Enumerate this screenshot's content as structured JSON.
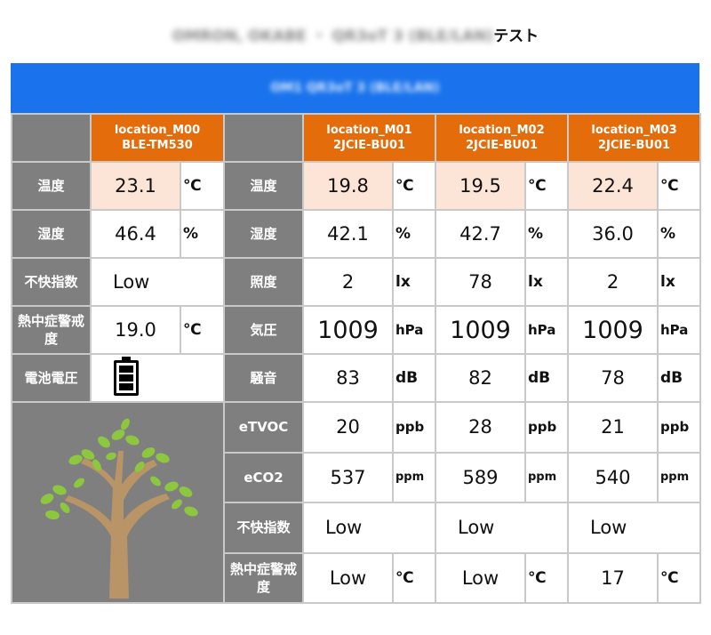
{
  "page_title": {
    "blurred": "OMRON, OKABE ・ QR3oT 3 (BLE/LAN)",
    "suffix": "テスト"
  },
  "banner": "OM1 QR3oT 3 (BLE/LAN)",
  "m00": {
    "header_line1": "location_M00",
    "header_line2": "BLE-TM530"
  },
  "m00_rows": [
    {
      "label": "温度",
      "value": "23.1",
      "unit": "℃"
    },
    {
      "label": "湿度",
      "value": "46.4",
      "unit": "%"
    },
    {
      "label": "不快指数",
      "value": "Low"
    },
    {
      "label": "熱中症警戒度",
      "value": "19.0",
      "unit": "℃"
    },
    {
      "label": "電池電圧",
      "icon": "battery-full-icon",
      "battery_level": 1.0
    }
  ],
  "sensors": [
    {
      "header_line1": "location_M01",
      "header_line2": "2JCIE-BU01"
    },
    {
      "header_line1": "location_M02",
      "header_line2": "2JCIE-BU01"
    },
    {
      "header_line1": "location_M03",
      "header_line2": "2JCIE-BU01"
    }
  ],
  "sensor_rows": [
    {
      "label": "温度",
      "unit": "℃",
      "values": [
        "19.8",
        "19.5",
        "22.4"
      ]
    },
    {
      "label": "湿度",
      "unit": "%",
      "values": [
        "42.1",
        "42.7",
        "36.0"
      ]
    },
    {
      "label": "照度",
      "unit": "lx",
      "values": [
        "2",
        "78",
        "2"
      ]
    },
    {
      "label": "気圧",
      "unit": "hPa",
      "values": [
        "1009",
        "1009",
        "1009"
      ]
    },
    {
      "label": "騒音",
      "unit": "dB",
      "values": [
        "83",
        "82",
        "78"
      ]
    },
    {
      "label": "eTVOC",
      "unit": "ppb",
      "values": [
        "20",
        "28",
        "21"
      ]
    },
    {
      "label": "eCO2",
      "unit": "ppm",
      "values": [
        "537",
        "589",
        "540"
      ]
    },
    {
      "label": "不快指数",
      "values": [
        "Low",
        "Low",
        "Low"
      ]
    },
    {
      "label": "熱中症警戒度",
      "unit": "℃",
      "values": [
        "Low",
        "Low",
        "17"
      ]
    }
  ],
  "decor": {
    "icon": "tree-icon"
  },
  "colors": {
    "banner": "#1a73ec",
    "header": "#e46c0a",
    "label_bg": "#7f7f7f",
    "highlight": "#fce4d6",
    "grid_border": "#c9c9c9"
  }
}
